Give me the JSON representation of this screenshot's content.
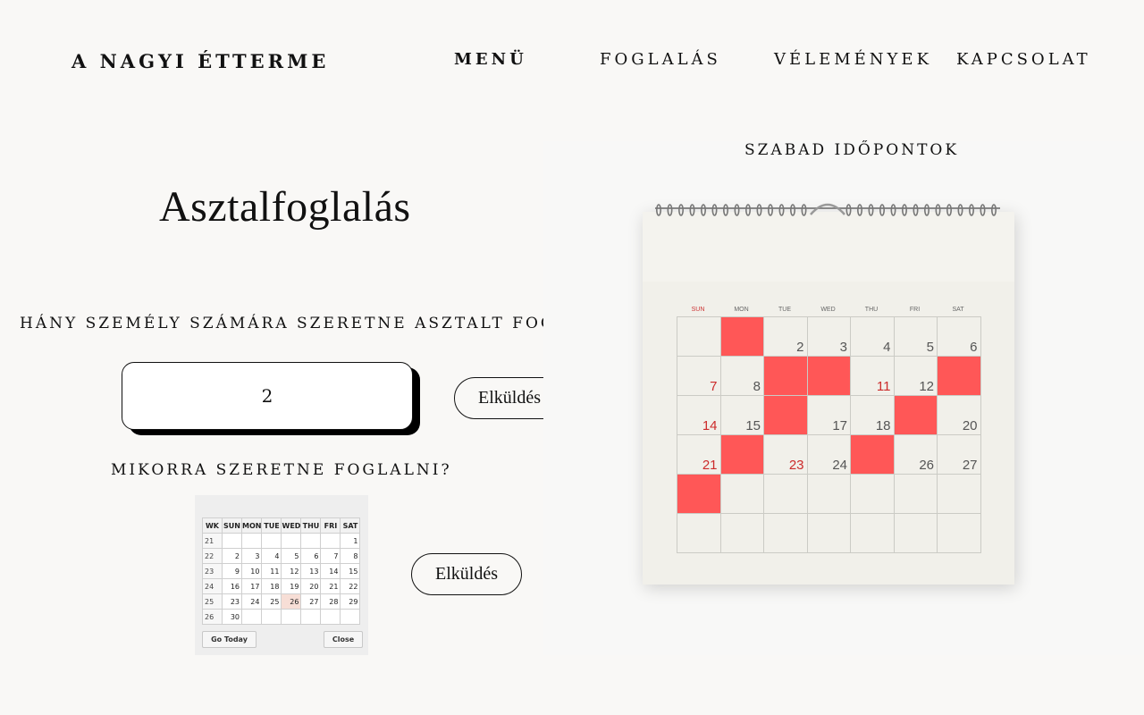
{
  "header": {
    "brand": "A NAGYI ÉTTERME",
    "nav": [
      "MENÜ",
      "FOGLALÁS",
      "VÉLEMÉNYEK",
      "KAPCSOLAT"
    ],
    "active_nav": "MENÜ"
  },
  "form": {
    "title": "Asztalfoglalás",
    "people_question": "HÁNY SZEMÉLY SZÁMÁRA SZERETNE ASZTALT FOGLALNI?",
    "people_value": "2",
    "submit_label": "Elküldés",
    "date_question": "MIKORRA SZERETNE FOGLALNI?",
    "submit_label_2": "Elküldés"
  },
  "datepicker": {
    "headers": [
      "WK",
      "SUN",
      "MON",
      "TUE",
      "WED",
      "THU",
      "FRI",
      "SAT"
    ],
    "rows": [
      [
        "21",
        "",
        "",
        "",
        "",
        "",
        "",
        "1"
      ],
      [
        "22",
        "2",
        "3",
        "4",
        "5",
        "6",
        "7",
        "8"
      ],
      [
        "23",
        "9",
        "10",
        "11",
        "12",
        "13",
        "14",
        "15"
      ],
      [
        "24",
        "16",
        "17",
        "18",
        "19",
        "20",
        "21",
        "22"
      ],
      [
        "25",
        "23",
        "24",
        "25",
        "26",
        "27",
        "28",
        "29"
      ],
      [
        "26",
        "30",
        "",
        "",
        "",
        "",
        "",
        ""
      ]
    ],
    "today": "26",
    "go_today": "Go Today",
    "close": "Close"
  },
  "availability": {
    "title": "SZABAD IDŐPONTOK",
    "weekdays": [
      "SUN",
      "MON",
      "TUE",
      "WED",
      "THU",
      "FRI",
      "SAT"
    ],
    "booked_color": "#ff5757",
    "cells": [
      {
        "d": "",
        "booked": false
      },
      {
        "d": "",
        "booked": true
      },
      {
        "d": "2",
        "booked": false
      },
      {
        "d": "3",
        "booked": false
      },
      {
        "d": "4",
        "booked": false
      },
      {
        "d": "5",
        "booked": false
      },
      {
        "d": "6",
        "booked": false
      },
      {
        "d": "7",
        "booked": false,
        "red": true
      },
      {
        "d": "8",
        "booked": false
      },
      {
        "d": "",
        "booked": true
      },
      {
        "d": "",
        "booked": true
      },
      {
        "d": "11",
        "booked": false,
        "red": true
      },
      {
        "d": "12",
        "booked": false
      },
      {
        "d": "",
        "booked": true
      },
      {
        "d": "14",
        "booked": false,
        "red": true
      },
      {
        "d": "15",
        "booked": false
      },
      {
        "d": "",
        "booked": true
      },
      {
        "d": "17",
        "booked": false
      },
      {
        "d": "18",
        "booked": false
      },
      {
        "d": "",
        "booked": true
      },
      {
        "d": "20",
        "booked": false
      },
      {
        "d": "21",
        "booked": false,
        "red": true
      },
      {
        "d": "",
        "booked": true
      },
      {
        "d": "23",
        "booked": false,
        "red": true
      },
      {
        "d": "24",
        "booked": false
      },
      {
        "d": "",
        "booked": true
      },
      {
        "d": "26",
        "booked": false
      },
      {
        "d": "27",
        "booked": false
      },
      {
        "d": "",
        "booked": true
      },
      {
        "d": "",
        "booked": false
      },
      {
        "d": "",
        "booked": false
      },
      {
        "d": "",
        "booked": false
      },
      {
        "d": "",
        "booked": false
      },
      {
        "d": "",
        "booked": false
      },
      {
        "d": "",
        "booked": false
      },
      {
        "d": "",
        "booked": false
      },
      {
        "d": "",
        "booked": false
      },
      {
        "d": "",
        "booked": false
      },
      {
        "d": "",
        "booked": false
      },
      {
        "d": "",
        "booked": false
      },
      {
        "d": "",
        "booked": false
      },
      {
        "d": "",
        "booked": false
      }
    ]
  }
}
